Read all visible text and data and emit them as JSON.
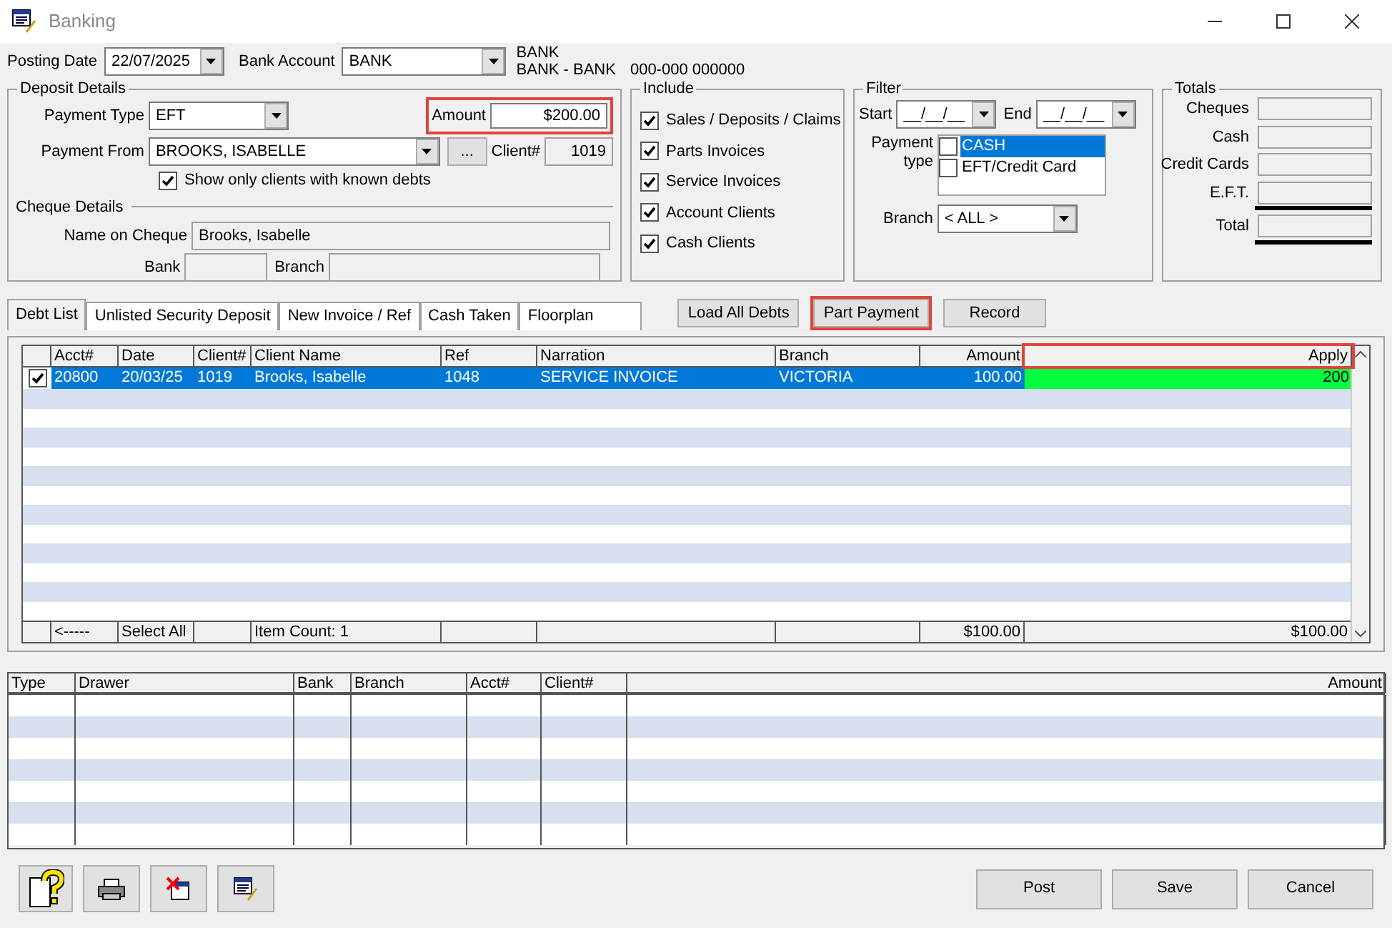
{
  "window": {
    "title": "Banking"
  },
  "posting_date": {
    "label": "Posting Date",
    "value": "22/07/2025"
  },
  "bank_account": {
    "label": "Bank Account",
    "value": "BANK",
    "info_line_1": "BANK",
    "info_line_2": "BANK - BANK",
    "info_code": "000-000  000000"
  },
  "deposit_details": {
    "title": "Deposit Details",
    "payment_type_label": "Payment Type",
    "payment_type": "EFT",
    "amount_label": "Amount",
    "amount": "$200.00",
    "amount_highlighted": true,
    "payment_from_label": "Payment From",
    "payment_from": "BROOKS, ISABELLE",
    "browse_button": "...",
    "client_label": "Client#",
    "client": "1019",
    "known_debts": {
      "label": "Show only clients with known debts",
      "checked": true
    },
    "cheque_title": "Cheque Details",
    "name_label": "Name on Cheque",
    "name": "Brooks, Isabelle",
    "bank_label": "Bank",
    "branch_label": "Branch"
  },
  "include": {
    "title": "Include",
    "items": [
      {
        "label": "Sales / Deposits / Claims",
        "checked": true
      },
      {
        "label": "Parts Invoices",
        "checked": true
      },
      {
        "label": "Service Invoices",
        "checked": true
      },
      {
        "label": "Account Clients",
        "checked": true
      },
      {
        "label": "Cash Clients",
        "checked": true
      }
    ]
  },
  "filter": {
    "title": "Filter",
    "start_label": "Start",
    "start": "__/__/__",
    "end_label": "End",
    "end": "__/__/__",
    "payment_type_label_1": "Payment",
    "payment_type_label_2": "type",
    "payment_types": [
      {
        "label": "CASH",
        "checked": false,
        "selected": true
      },
      {
        "label": "EFT/Credit Card",
        "checked": false,
        "selected": false
      }
    ],
    "branch_label": "Branch",
    "branch": "< ALL >"
  },
  "totals": {
    "title": "Totals",
    "items": [
      {
        "label": "Cheques",
        "double_rule": false
      },
      {
        "label": "Cash",
        "double_rule": false
      },
      {
        "label": "Credit Cards",
        "double_rule": false
      },
      {
        "label": "E.F.T.",
        "double_rule": true
      },
      {
        "label": "Total",
        "double_rule": true
      }
    ]
  },
  "tabs": [
    {
      "label": "Debt List",
      "selected": true
    },
    {
      "label": "Unlisted Security Deposit",
      "selected": false
    },
    {
      "label": "New Invoice / Ref",
      "selected": false
    },
    {
      "label": "Cash Taken",
      "selected": false
    },
    {
      "label": "Floorplan",
      "selected": false
    }
  ],
  "actions": [
    {
      "label": "Load All Debts",
      "highlighted": false
    },
    {
      "label": "Part Payment",
      "highlighted": true
    },
    {
      "label": "Record",
      "highlighted": false
    }
  ],
  "debt_table": {
    "columns": [
      "Acct#",
      "Date",
      "Client#",
      "Client Name",
      "Ref",
      "Narration",
      "Branch",
      "Amount",
      "Apply"
    ],
    "apply_highlighted": true,
    "rows": [
      {
        "checked": true,
        "selected": true,
        "cells": [
          "20800",
          "20/03/25",
          "1019",
          "Brooks, Isabelle",
          "1048",
          "SERVICE INVOICE",
          "VICTORIA",
          "100.00",
          "200"
        ]
      }
    ],
    "footer": {
      "marker": "<-----",
      "select_all": "Select All",
      "item_count": "Item Count: 1",
      "amount_total": "$100.00",
      "apply_total": "$100.00"
    }
  },
  "cheque_table": {
    "columns": [
      "Type",
      "Drawer",
      "Bank",
      "Branch",
      "Acct#",
      "Client#",
      "Amount"
    ]
  },
  "buttons": [
    "Post",
    "Save",
    "Cancel"
  ]
}
